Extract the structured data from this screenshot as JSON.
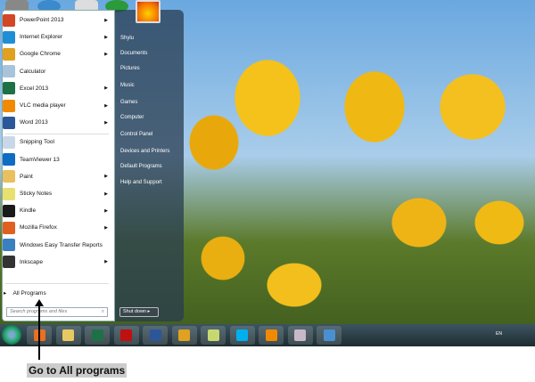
{
  "start_menu": {
    "programs": [
      {
        "label": "PowerPoint 2013",
        "icon": "powerpoint-icon",
        "color": "#d24726",
        "arrow": true
      },
      {
        "label": "Internet Explorer",
        "icon": "internet-explorer-icon",
        "color": "#1e8fd6",
        "arrow": true
      },
      {
        "label": "Google Chrome",
        "icon": "chrome-icon",
        "color": "#e0a020",
        "arrow": true
      },
      {
        "label": "Calculator",
        "icon": "calculator-icon",
        "color": "#a8c4dc",
        "arrow": false
      },
      {
        "label": "Excel 2013",
        "icon": "excel-icon",
        "color": "#1e7145",
        "arrow": true
      },
      {
        "label": "VLC media player",
        "icon": "vlc-icon",
        "color": "#f08a00",
        "arrow": true
      },
      {
        "label": "Word 2013",
        "icon": "word-icon",
        "color": "#2b579a",
        "arrow": true
      },
      {
        "label": "Snipping Tool",
        "icon": "scissors-icon",
        "color": "#c8d8e8",
        "arrow": false
      },
      {
        "label": "TeamViewer 13",
        "icon": "teamviewer-icon",
        "color": "#0e6cc4",
        "arrow": false
      },
      {
        "label": "Paint",
        "icon": "paint-icon",
        "color": "#e8c060",
        "arrow": true
      },
      {
        "label": "Sticky Notes",
        "icon": "sticky-notes-icon",
        "color": "#e8e070",
        "arrow": true
      },
      {
        "label": "Kindle",
        "icon": "kindle-icon",
        "color": "#1a1a1a",
        "arrow": true
      },
      {
        "label": "Mozilla Firefox",
        "icon": "firefox-icon",
        "color": "#e06020",
        "arrow": true
      },
      {
        "label": "Windows Easy Transfer Reports",
        "icon": "transfer-icon",
        "color": "#3a80c0",
        "arrow": false
      },
      {
        "label": "Inkscape",
        "icon": "inkscape-icon",
        "color": "#333333",
        "arrow": true
      }
    ],
    "all_programs": "All Programs",
    "search_placeholder": "Search programs and files",
    "right": [
      "Shylu",
      "Documents",
      "Pictures",
      "Music",
      "Games",
      "Computer",
      "Control Panel",
      "Devices and Printers",
      "Default Programs",
      "Help and Support"
    ],
    "shutdown": "Shut down"
  },
  "taskbar": {
    "apps": [
      {
        "name": "media-player-icon",
        "color": "#e87020"
      },
      {
        "name": "file-explorer-icon",
        "color": "#e8c860"
      },
      {
        "name": "excel-icon",
        "color": "#1e7145"
      },
      {
        "name": "red-app-icon",
        "color": "#c01010"
      },
      {
        "name": "word-icon",
        "color": "#2b579a"
      },
      {
        "name": "chrome-icon",
        "color": "#e0a020"
      },
      {
        "name": "sticky-notes-icon",
        "color": "#c8d870"
      },
      {
        "name": "skype-icon",
        "color": "#00aff0"
      },
      {
        "name": "vlc-icon",
        "color": "#f08a00"
      },
      {
        "name": "snipping-tool-icon",
        "color": "#c8b8c8"
      },
      {
        "name": "remote-desktop-icon",
        "color": "#4a90d0"
      }
    ],
    "language": "EN"
  },
  "caption": "Go to All programs"
}
